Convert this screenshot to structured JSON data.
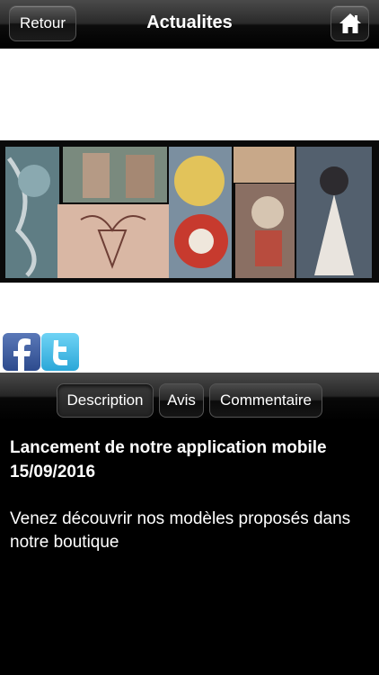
{
  "navbar": {
    "back_label": "Retour",
    "title": "Actualites",
    "home_icon": "home-icon"
  },
  "social": {
    "facebook_icon": "facebook-icon",
    "twitter_icon": "twitter-icon"
  },
  "tabs": [
    {
      "label": "Description",
      "active": true
    },
    {
      "label": "Avis",
      "active": false
    },
    {
      "label": "Commentaire",
      "active": false
    }
  ],
  "article": {
    "headline": "Lancement de notre application mobile",
    "date": "15/09/2016",
    "body": "Venez découvrir nos modèles proposés dans notre boutique"
  },
  "colors": {
    "background": "#000000",
    "content_area": "#ffffff",
    "text": "#ffffff"
  }
}
